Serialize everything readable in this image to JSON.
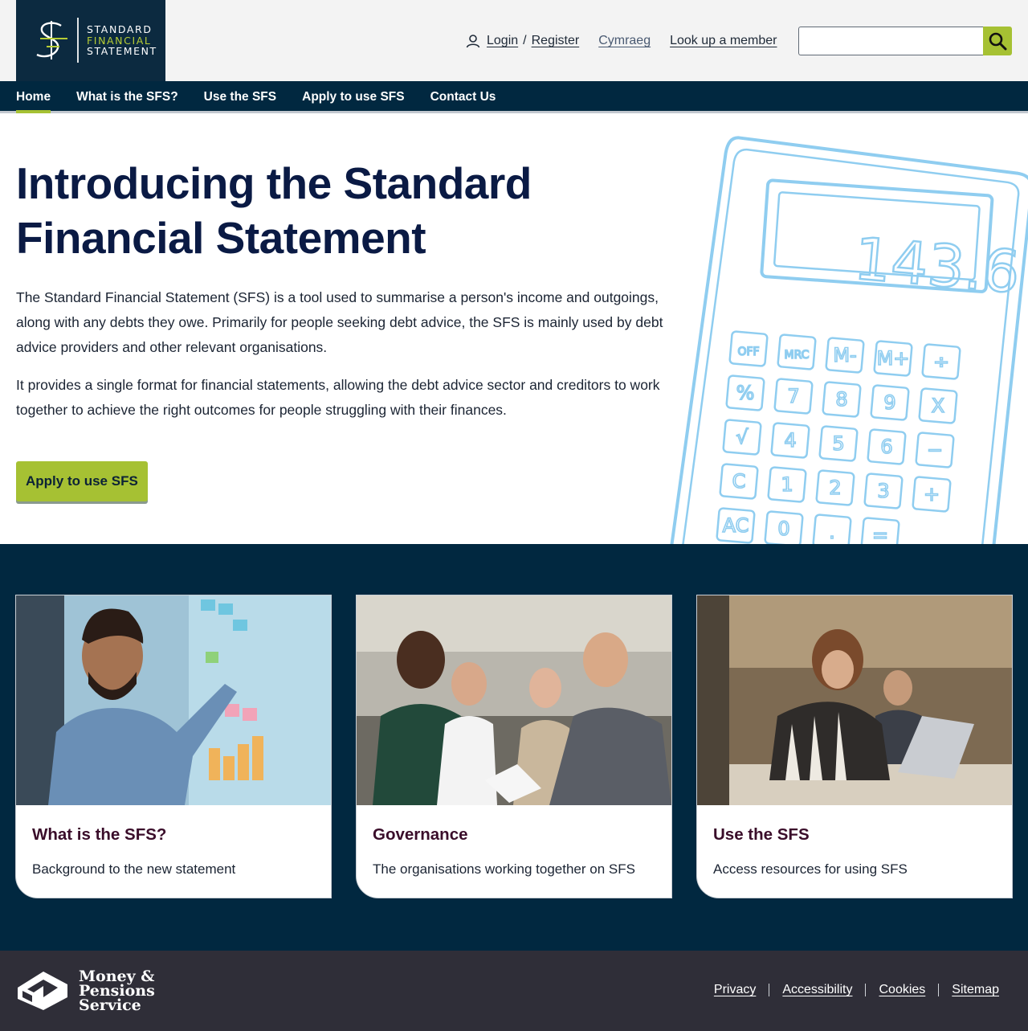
{
  "header": {
    "logo": {
      "lines": [
        "STANDARD",
        "FINANCIAL",
        "STATEMENT"
      ]
    },
    "login_label": "Login",
    "separator": "/",
    "register_label": "Register",
    "cymraeg_label": "Cymraeg",
    "lookup_label": "Look up a member",
    "search_value": "",
    "icons": {
      "user": "user-icon",
      "search": "search-icon"
    }
  },
  "nav": {
    "items": [
      {
        "label": "Home",
        "active": true
      },
      {
        "label": "What is the SFS?"
      },
      {
        "label": "Use the SFS"
      },
      {
        "label": "Apply to use SFS"
      },
      {
        "label": "Contact Us"
      }
    ]
  },
  "hero": {
    "title_line1": "Introducing the Standard",
    "title_line2": "Financial Statement",
    "para1": "The Standard Financial Statement (SFS) is a tool used to summarise a person's income and outgoings, along with any debts they owe. Primarily for people seeking debt advice, the SFS is mainly used by debt advice providers and other relevant organisations.",
    "para2": "It provides a single format for financial statements, allowing the debt advice sector and creditors to work together to achieve the right outcomes for people struggling with their finances.",
    "cta_label": "Apply to use SFS",
    "calculator": {
      "display": "143.6",
      "keys": [
        "OFF",
        "MRC",
        "M-",
        "M+",
        "÷",
        "%",
        "7",
        "8",
        "9",
        "X",
        "√",
        "4",
        "5",
        "6",
        "−",
        "C",
        "1",
        "2",
        "3",
        "+",
        "AC",
        "0",
        ".",
        "="
      ]
    }
  },
  "cards": [
    {
      "title": "What is the SFS?",
      "desc": "Background to the new statement"
    },
    {
      "title": "Governance",
      "desc": "The organisations working together on SFS"
    },
    {
      "title": "Use the SFS",
      "desc": "Access resources for using SFS"
    }
  ],
  "footer": {
    "brand_lines": [
      "Money &",
      "Pensions",
      "Service"
    ],
    "links": [
      "Privacy",
      "Accessibility",
      "Cookies",
      "Sitemap"
    ]
  },
  "colors": {
    "navy": "#012840",
    "lime": "#a6c133",
    "heading": "#0a1a44",
    "card_title": "#3a0d2a",
    "footer_bg": "#2f2e38",
    "calculator_line": "#8fcdf0"
  }
}
